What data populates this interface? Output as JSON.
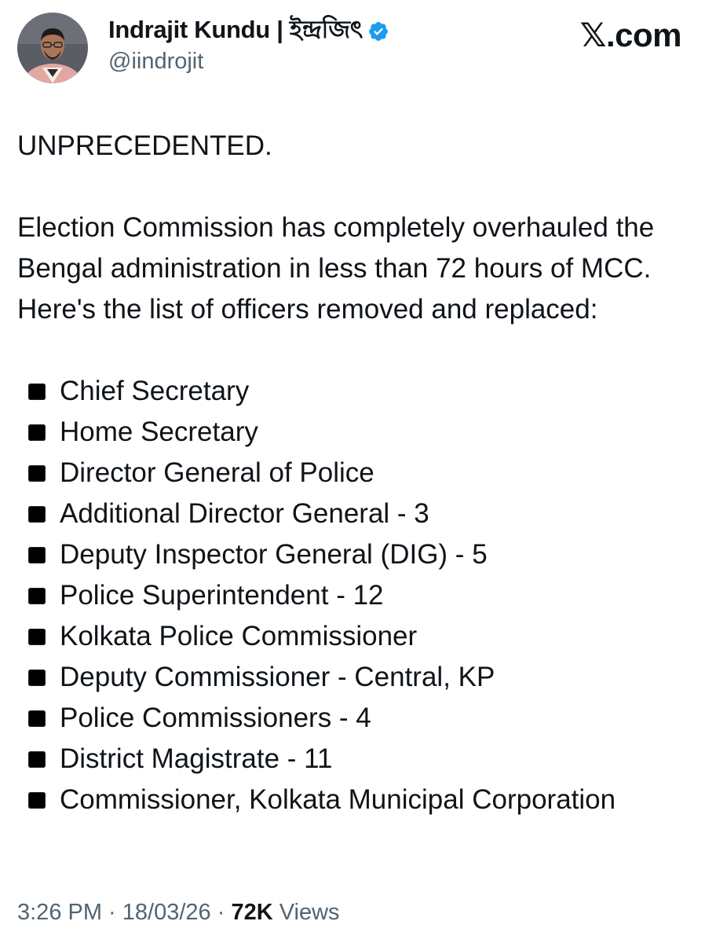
{
  "author": {
    "display_name": "Indrajit Kundu | ইন্দ্রজিৎ",
    "handle": "@iindrojit",
    "verified_icon": "verified-badge-icon",
    "verified_color": "#1d9bf0"
  },
  "brand": {
    "x_mark": "𝕏",
    "domain": ".com"
  },
  "post": {
    "headline": "UNPRECEDENTED.",
    "paragraph": "Election Commission has completely overhauled the Bengal administration in less than 72 hours of MCC. Here's the list of officers removed and replaced:",
    "bullet_icon": "black-square-icon",
    "items": [
      "Chief Secretary",
      "Home Secretary",
      "Director General of Police",
      "Additional Director General - 3",
      "Deputy Inspector General (DIG) - 5",
      "Police Superintendent - 12",
      "Kolkata Police Commissioner",
      "Deputy Commissioner - Central, KP",
      "Police Commissioners - 4",
      "District Magistrate - 11",
      "Commissioner, Kolkata Municipal Corporation"
    ]
  },
  "meta": {
    "time": "3:26 PM",
    "sep1": " · ",
    "date": "18/03/26",
    "sep2": " · ",
    "views_count": "72K",
    "views_label": " Views"
  },
  "colors": {
    "text": "#0f1419",
    "secondary": "#536471",
    "verified": "#1d9bf0"
  }
}
